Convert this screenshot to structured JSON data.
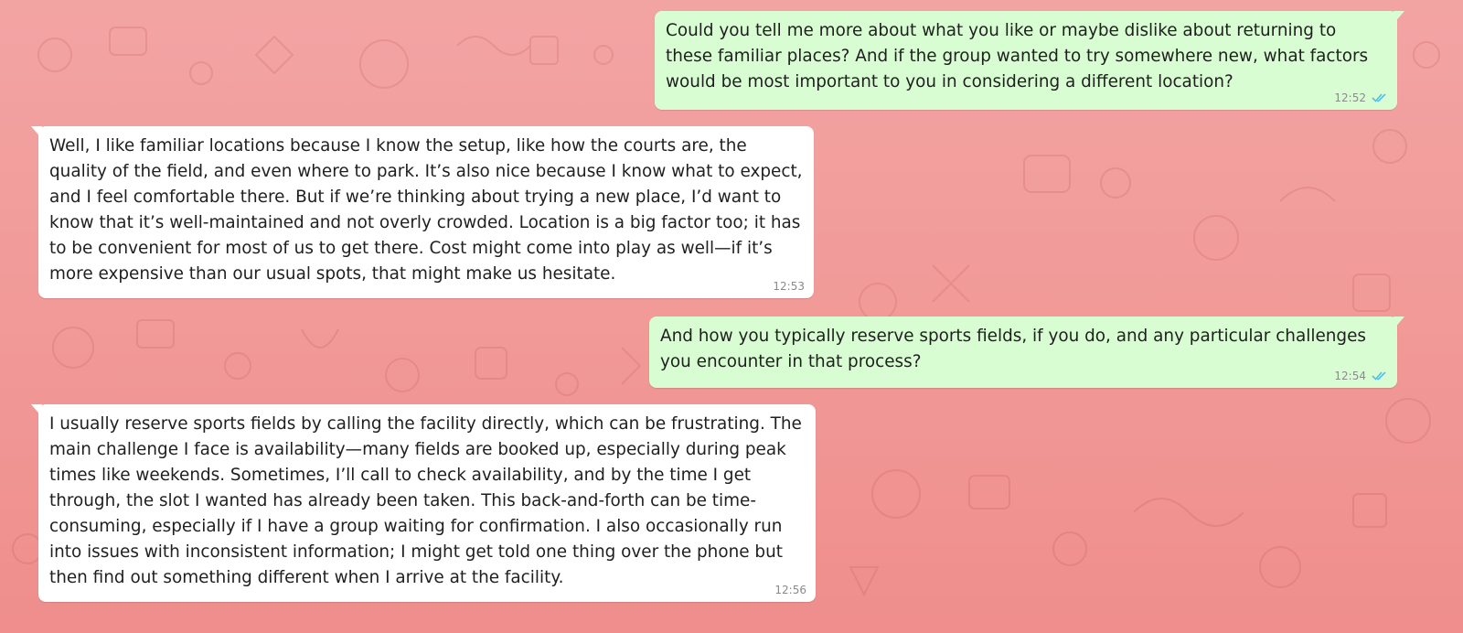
{
  "messages": [
    {
      "direction": "out",
      "text": "Could you tell me more about what you like or maybe dislike about returning to these familiar places? And if the group wanted to try somewhere new, what factors would be most important to you in considering a different location?",
      "time": "12:52",
      "status": "read"
    },
    {
      "direction": "in",
      "text": "Well, I like familiar locations because I know the setup, like how the courts are, the quality of the field, and even where to park. It’s also nice because I know what to expect, and I feel comfortable there. But if we’re thinking about trying a new place, I’d want to know that it’s well-maintained and not overly crowded. Location is a big factor too; it has to be convenient for most of us to get there. Cost might come into play as well—if it’s more expensive than our usual spots, that might make us hesitate.",
      "time": "12:53"
    },
    {
      "direction": "out",
      "text": "And how you typically reserve sports fields, if you do, and any particular challenges you encounter in that process?",
      "time": "12:54",
      "status": "read"
    },
    {
      "direction": "in",
      "text": "I usually reserve sports fields by calling the facility directly, which can be frustrating. The main challenge I face is availability—many fields are booked up, especially during peak times like weekends. Sometimes, I’ll call to check availability, and by the time I get through, the slot I wanted has already been taken. This back-and-forth can be time-consuming, especially if I have a group waiting for confirmation. I also occasionally run into issues with inconsistent information; I might get told one thing over the phone but then find out something different when I arrive at the facility.",
      "time": "12:56"
    }
  ],
  "colors": {
    "background": "#f19a98",
    "incoming_bubble": "#ffffff",
    "outgoing_bubble": "#d9fdd3",
    "read_ticks": "#53bdeb"
  }
}
